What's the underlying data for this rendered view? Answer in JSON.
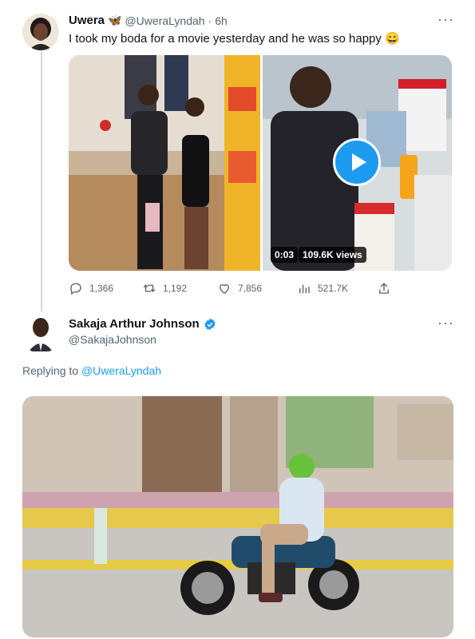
{
  "tweet1": {
    "display_name": "Uwera",
    "name_emoji": "🦋",
    "handle": "@UweraLyndah",
    "separator": "·",
    "time": "6h",
    "text": "I took my boda for a movie yesterday and he was so happy",
    "text_emoji": "😄",
    "video": {
      "duration": "0:03",
      "views": "109.6K views"
    },
    "actions": {
      "replies": "1,366",
      "retweets": "1,192",
      "likes": "7,856",
      "views": "521.7K"
    },
    "more_icon": "more-horizontal-icon"
  },
  "tweet2": {
    "display_name": "Sakaja Arthur Johnson",
    "handle": "@SakajaJohnson",
    "verified_icon": "verified-badge-icon",
    "replying_prefix": "Replying to",
    "replying_handle": "@UweraLyndah",
    "more_icon": "more-horizontal-icon"
  },
  "colors": {
    "accent": "#1d9bf0",
    "muted": "#536471",
    "text": "#0f1419",
    "divider": "#cfd9de"
  }
}
